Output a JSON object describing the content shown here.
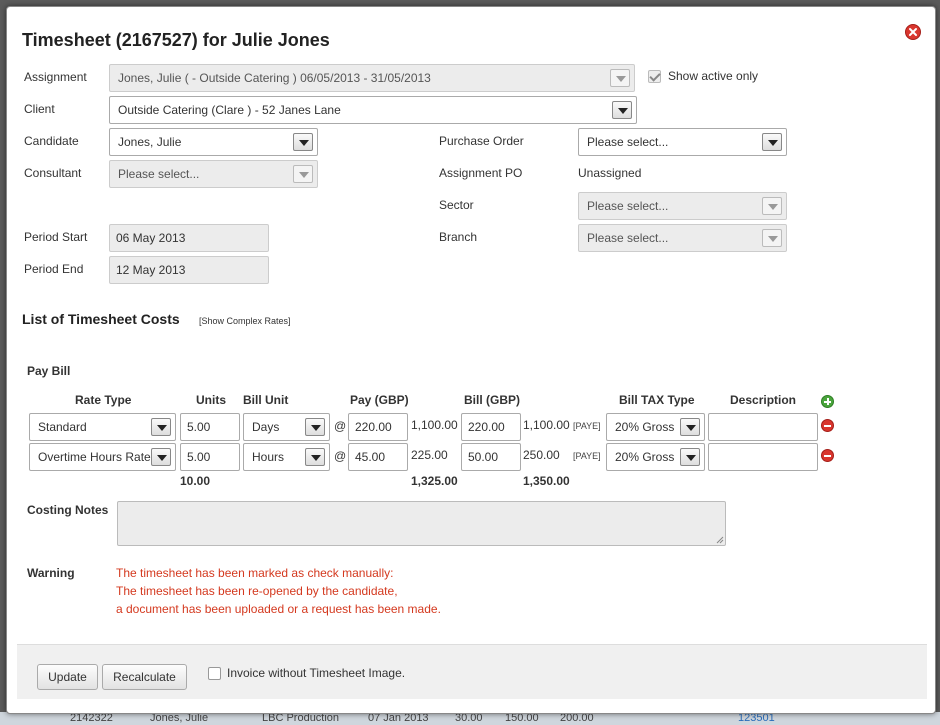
{
  "dialog": {
    "title": "Timesheet (2167527) for Julie Jones"
  },
  "background_row": {
    "cols": [
      "2142322",
      "Jones, Julie",
      "LBC Production",
      "07 Jan 2013",
      "30.00",
      "150.00",
      "200.00",
      "123501"
    ]
  },
  "form": {
    "assignment_label": "Assignment",
    "assignment_value": "Jones, Julie ( - Outside Catering ) 06/05/2013 - 31/05/2013",
    "show_active_label": "Show active only",
    "show_active_checked": true,
    "client_label": "Client",
    "client_value": "Outside Catering (Clare ) - 52 Janes Lane",
    "candidate_label": "Candidate",
    "candidate_value": "Jones, Julie",
    "consultant_label": "Consultant",
    "consultant_value": "Please select...",
    "period_start_label": "Period Start",
    "period_start_value": "06 May 2013",
    "period_end_label": "Period End",
    "period_end_value": "12 May 2013",
    "purchase_order_label": "Purchase Order",
    "purchase_order_value": "Please select...",
    "assignment_po_label": "Assignment PO",
    "assignment_po_value": "Unassigned",
    "sector_label": "Sector",
    "sector_value": "Please select...",
    "branch_label": "Branch",
    "branch_value": "Please select..."
  },
  "costs": {
    "section_title": "List of Timesheet Costs",
    "show_complex_link": "[Show Complex Rates]",
    "pay_bill_label": "Pay Bill",
    "headers": {
      "rate_type": "Rate Type",
      "units": "Units",
      "bill_unit": "Bill Unit",
      "pay": "Pay (GBP)",
      "bill": "Bill (GBP)",
      "bill_tax": "Bill TAX Type",
      "description": "Description"
    },
    "at_symbol": "@",
    "rows": [
      {
        "rate_type": "Standard",
        "units": "5.00",
        "bill_unit": "Days",
        "pay_rate": "220.00",
        "pay_total": "1,100.00",
        "bill_rate": "220.00",
        "bill_total": "1,100.00",
        "tax_tag": "[PAYE]",
        "bill_tax": "20% Gross",
        "description": ""
      },
      {
        "rate_type": "Overtime Hours Rate",
        "units": "5.00",
        "bill_unit": "Hours",
        "pay_rate": "45.00",
        "pay_total": "225.00",
        "bill_rate": "50.00",
        "bill_total": "250.00",
        "tax_tag": "[PAYE]",
        "bill_tax": "20% Gross",
        "description": ""
      }
    ],
    "totals": {
      "units": "10.00",
      "pay": "1,325.00",
      "bill": "1,350.00"
    }
  },
  "notes": {
    "costing_notes_label": "Costing Notes",
    "warning_label": "Warning",
    "warning_lines": [
      "The timesheet has been marked as check manually:",
      "The timesheet has been re-opened by the candidate,",
      "a document has been uploaded or a request has been made."
    ]
  },
  "footer": {
    "update_button": "Update",
    "recalculate_button": "Recalculate",
    "invoice_without_image_label": "Invoice without Timesheet Image.",
    "invoice_without_image_checked": false
  },
  "colors": {
    "warning": "#d4391f",
    "close": "#d9362e",
    "add": "#4aa53c"
  }
}
